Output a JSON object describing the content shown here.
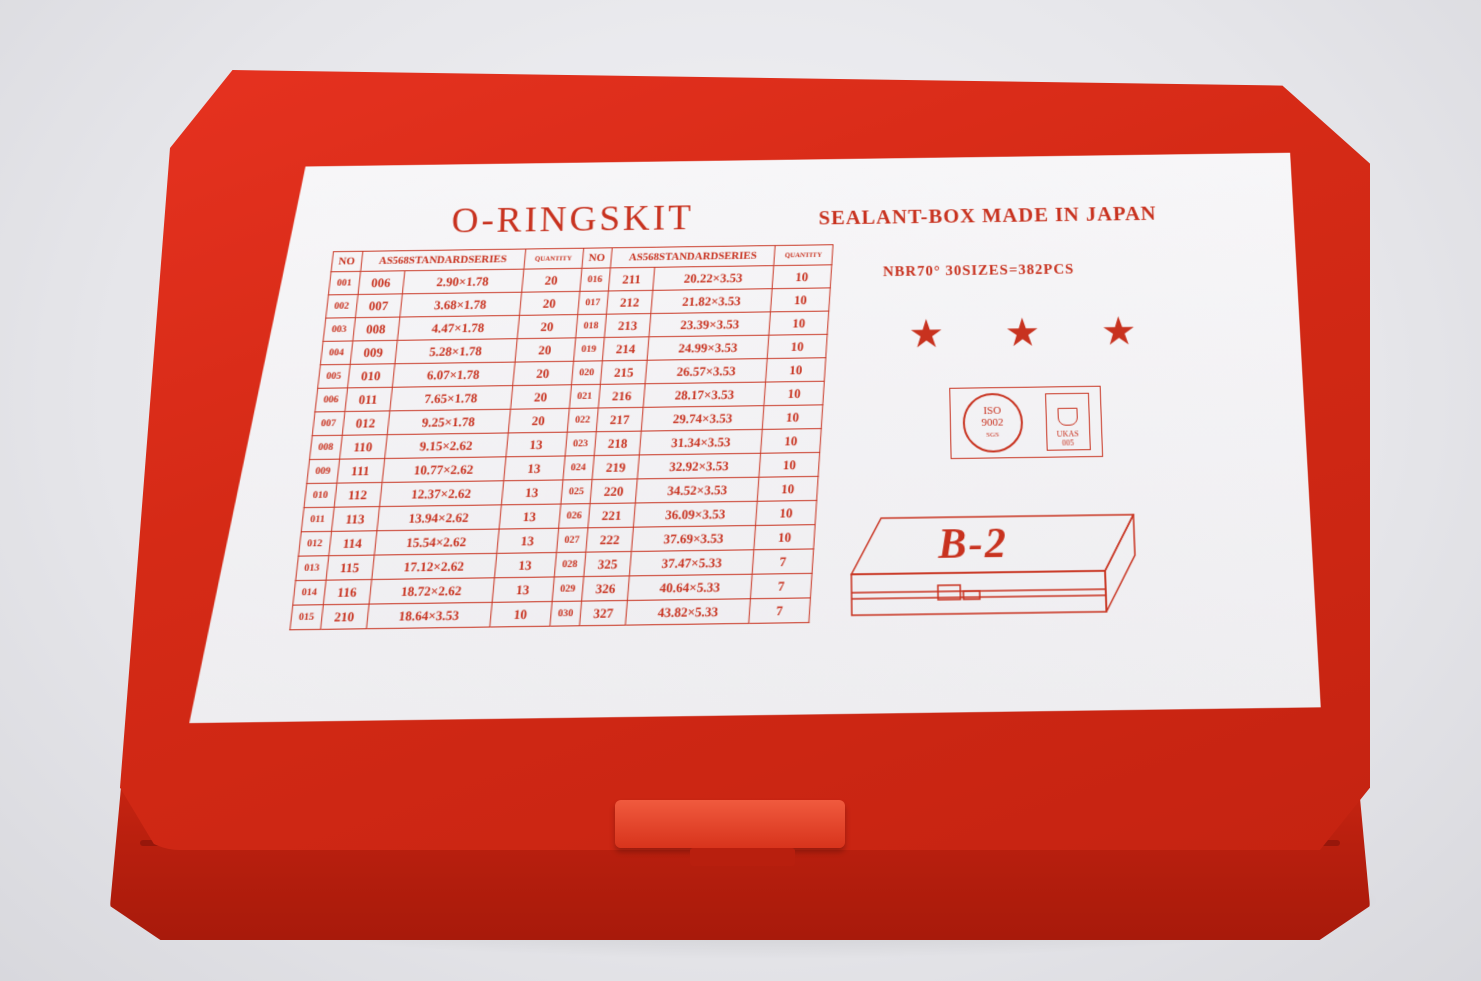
{
  "label": {
    "title": "O-RINGSKIT",
    "subtitle": "SEALANT-BOX MADE IN JAPAN",
    "spec": "NBR70°  30SIZES=382PCS",
    "stars": [
      "★",
      "★",
      "★"
    ],
    "iso_seal": {
      "line1": "ISO",
      "line2": "9002",
      "line3": "SGS"
    },
    "ukas_seal": {
      "line1": "UKAS",
      "line2": "005"
    },
    "model": "B-2"
  },
  "table": {
    "headers": [
      "NO",
      "AS568STANDARDSERIES",
      "QUANTITY",
      "NO",
      "AS568STANDARDSERIES",
      "QUANTITY"
    ],
    "left": [
      [
        "001",
        "006",
        "2.90×1.78",
        "20"
      ],
      [
        "002",
        "007",
        "3.68×1.78",
        "20"
      ],
      [
        "003",
        "008",
        "4.47×1.78",
        "20"
      ],
      [
        "004",
        "009",
        "5.28×1.78",
        "20"
      ],
      [
        "005",
        "010",
        "6.07×1.78",
        "20"
      ],
      [
        "006",
        "011",
        "7.65×1.78",
        "20"
      ],
      [
        "007",
        "012",
        "9.25×1.78",
        "20"
      ],
      [
        "008",
        "110",
        "9.15×2.62",
        "13"
      ],
      [
        "009",
        "111",
        "10.77×2.62",
        "13"
      ],
      [
        "010",
        "112",
        "12.37×2.62",
        "13"
      ],
      [
        "011",
        "113",
        "13.94×2.62",
        "13"
      ],
      [
        "012",
        "114",
        "15.54×2.62",
        "13"
      ],
      [
        "013",
        "115",
        "17.12×2.62",
        "13"
      ],
      [
        "014",
        "116",
        "18.72×2.62",
        "13"
      ],
      [
        "015",
        "210",
        "18.64×3.53",
        "10"
      ]
    ],
    "right": [
      [
        "016",
        "211",
        "20.22×3.53",
        "10"
      ],
      [
        "017",
        "212",
        "21.82×3.53",
        "10"
      ],
      [
        "018",
        "213",
        "23.39×3.53",
        "10"
      ],
      [
        "019",
        "214",
        "24.99×3.53",
        "10"
      ],
      [
        "020",
        "215",
        "26.57×3.53",
        "10"
      ],
      [
        "021",
        "216",
        "28.17×3.53",
        "10"
      ],
      [
        "022",
        "217",
        "29.74×3.53",
        "10"
      ],
      [
        "023",
        "218",
        "31.34×3.53",
        "10"
      ],
      [
        "024",
        "219",
        "32.92×3.53",
        "10"
      ],
      [
        "025",
        "220",
        "34.52×3.53",
        "10"
      ],
      [
        "026",
        "221",
        "36.09×3.53",
        "10"
      ],
      [
        "027",
        "222",
        "37.69×3.53",
        "10"
      ],
      [
        "028",
        "325",
        "37.47×5.33",
        "7"
      ],
      [
        "029",
        "326",
        "40.64×5.33",
        "7"
      ],
      [
        "030",
        "327",
        "43.82×5.33",
        "7"
      ]
    ]
  },
  "colors": {
    "box_red": "#d52a16",
    "label_ink": "#c8321f",
    "label_paper": "#f4f3f6"
  }
}
